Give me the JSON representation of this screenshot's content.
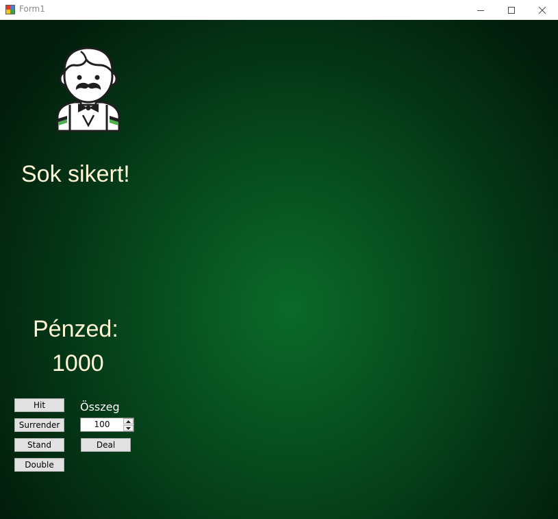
{
  "window": {
    "title": "Form1",
    "icon": "windows-forms-app-icon",
    "controls": [
      "minimize-icon",
      "maximize-icon",
      "close-icon"
    ]
  },
  "dealer": {
    "icon": "dealer-mustache-bowtie-avatar"
  },
  "message": "Sok sikert!",
  "money": {
    "label": "Pénzed:",
    "value": "1000"
  },
  "buttons": {
    "hit": "Hit",
    "surrender": "Surrender",
    "stand": "Stand",
    "double": "Double",
    "deal": "Deal"
  },
  "bet": {
    "label": "Összeg",
    "value": "100"
  },
  "colors": {
    "table_center": "#0b6a2a",
    "table_edge": "#021d0b",
    "text": "#fff7d6"
  }
}
